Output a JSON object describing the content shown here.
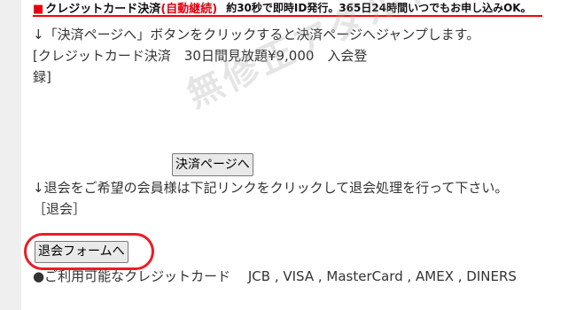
{
  "header": {
    "marker": "■",
    "title": "クレジットカード決済",
    "auto_label": "(自動継続)",
    "description": "約30秒で即時ID発行。365日24時間いつでもお申し込みOK。"
  },
  "body": {
    "instruction_jump": "↓「決済ページへ」ボタンをクリックすると決済ページへジャンプします。",
    "plan_line1": "[クレジットカード決済　30日間見放題¥9,000　入会登",
    "plan_line2": "録]",
    "settle_button": "決済ページへ",
    "withdraw_instruction": "↓退会をご希望の会員様は下記リンクをクリックして退会処理を行って下さい。",
    "withdraw_label": "［退会］",
    "withdraw_button": "退会フォームへ",
    "cards_line": "●ご利用可能なクレジットカード　 JCB , VISA , MasterCard , AMEX , DINERS"
  },
  "watermark": "無修正アダルト動画部！",
  "colors": {
    "accent_red": "#e60012",
    "highlight_ring": "#ee1c24"
  }
}
